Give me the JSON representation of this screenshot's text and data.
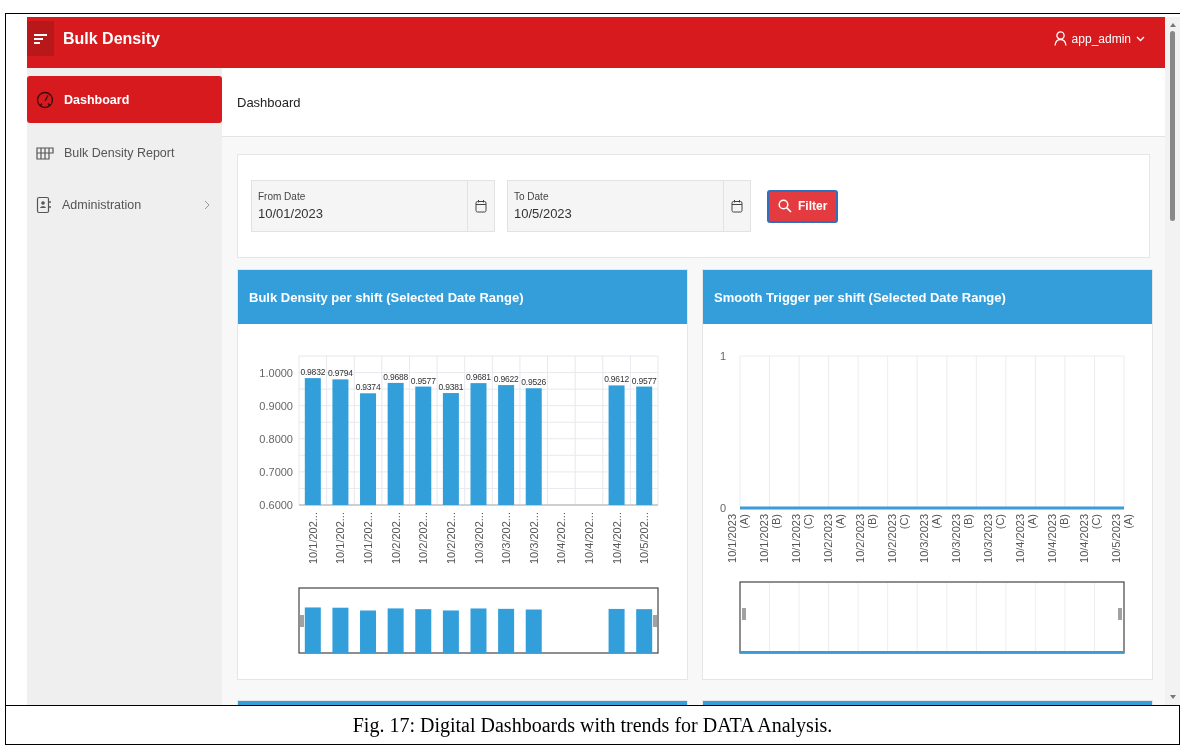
{
  "header": {
    "title": "Bulk Density",
    "user": "app_admin"
  },
  "sidebar": {
    "items": [
      {
        "label": "Dashboard",
        "selected": true,
        "kind": "dashboard",
        "expandable": false
      },
      {
        "label": "Bulk Density Report",
        "selected": false,
        "kind": "report",
        "expandable": false
      },
      {
        "label": "Administration",
        "selected": false,
        "kind": "admin",
        "expandable": true
      }
    ]
  },
  "breadcrumb": "Dashboard",
  "filters": {
    "fields": [
      {
        "label": "From Date",
        "value": "10/01/2023"
      },
      {
        "label": "To Date",
        "value": "10/5/2023"
      }
    ],
    "button": "Filter"
  },
  "charts": [
    {
      "title": "Bulk Density per shift (Selected Date Range)",
      "chart_data": {
        "type": "bar",
        "categories": [
          "10/1/202...",
          "10/1/202...",
          "10/1/202...",
          "10/2/202...",
          "10/2/202...",
          "10/2/202...",
          "10/3/202...",
          "10/3/202...",
          "10/3/202...",
          "10/4/202...",
          "10/4/202...",
          "10/4/202...",
          "10/5/202..."
        ],
        "values": [
          0.9832,
          0.9794,
          0.9374,
          0.9688,
          0.9577,
          0.9381,
          0.9681,
          0.9622,
          0.9526,
          null,
          null,
          0.9612,
          0.9577
        ],
        "ylim": [
          0.6,
          1.05
        ],
        "yticks": [
          {
            "value": 0.6,
            "label": "0.6000"
          },
          {
            "value": 0.7,
            "label": "0.7000"
          },
          {
            "value": 0.8,
            "label": "0.8000"
          },
          {
            "value": 0.9,
            "label": "0.9000"
          },
          {
            "value": 1.0,
            "label": "1.0000"
          }
        ],
        "data_labels": true,
        "grid": true
      }
    },
    {
      "title": "Smooth Trigger per shift (Selected Date Range)",
      "chart_data": {
        "type": "line",
        "categories": [
          "10/1/2023 (A)",
          "10/1/2023 (B)",
          "10/1/2023 (C)",
          "10/2/2023 (A)",
          "10/2/2023 (B)",
          "10/2/2023 (C)",
          "10/3/2023 (A)",
          "10/3/2023 (B)",
          "10/3/2023 (C)",
          "10/4/2023 (A)",
          "10/4/2023 (B)",
          "10/4/2023 (C)",
          "10/5/2023 (A)"
        ],
        "series": [
          {
            "color": "#3a9bd5",
            "values": [
              0,
              0,
              0,
              0,
              0,
              0,
              0,
              0,
              0,
              0,
              0,
              0,
              0
            ]
          }
        ],
        "ylim": [
          0,
          1
        ],
        "yticks": [
          0,
          1
        ],
        "grid": true
      }
    }
  ],
  "caption": "Fig. 17: Digital Dashboards with trends for DATA Analysis."
}
